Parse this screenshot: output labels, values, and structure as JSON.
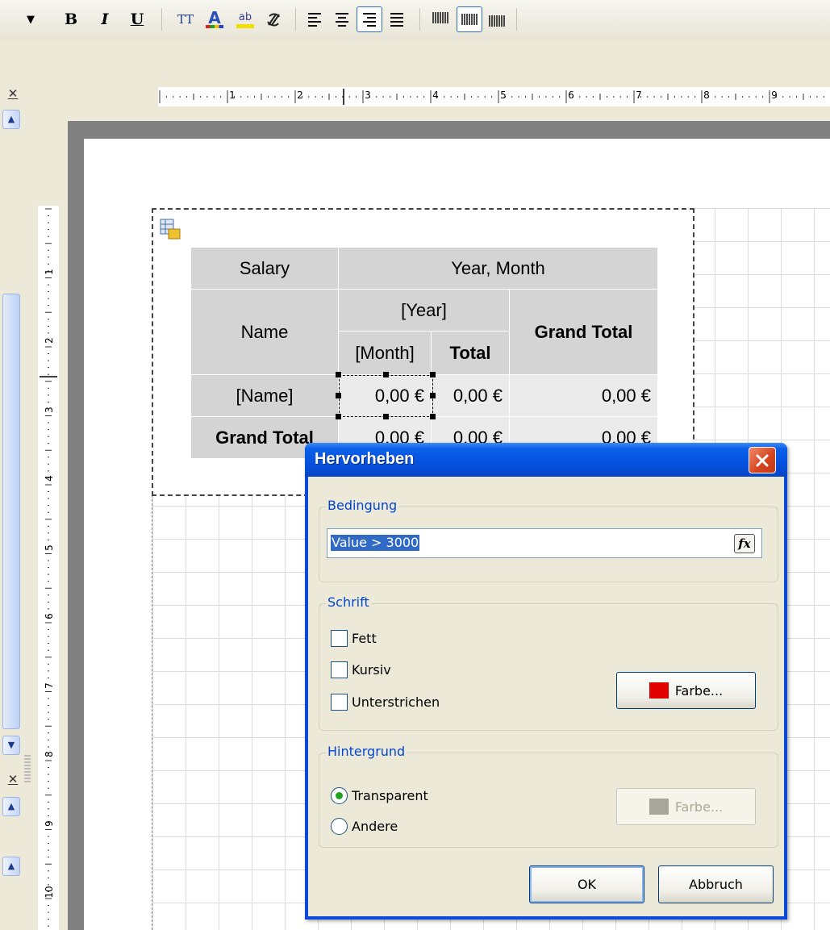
{
  "toolbar": {
    "bold_glyph": "B",
    "italic_glyph": "I",
    "underline_glyph": "U",
    "font_size_glyph": "TT",
    "font_color_glyph": "A",
    "highlight_glyph": "ab"
  },
  "rulers": {
    "horizontal_numbers": [
      "1",
      "2",
      "3",
      "4",
      "5",
      "6",
      "7",
      "8",
      "9"
    ],
    "vertical_numbers": [
      "1",
      "2",
      "3",
      "4",
      "5",
      "6",
      "7",
      "8",
      "9",
      "10"
    ]
  },
  "crosstab": {
    "salary": "Salary",
    "year_month": "Year, Month",
    "name": "Name",
    "year": "[Year]",
    "grand_total_header": "Grand Total",
    "month": "[Month]",
    "total": "Total",
    "name_field": "[Name]",
    "cell_value": "0,00 €",
    "total_value": "0,00 €",
    "grand_total_value": "0,00 €",
    "grand_total_row": "Grand Total",
    "row2_cell": "0,00 €",
    "row2_total": "0,00 €",
    "row2_grand": "0,00 €"
  },
  "dialog": {
    "title": "Hervorheben",
    "condition_group": "Bedingung",
    "condition_value": "Value > 3000",
    "fx_label": "fx",
    "font_group": "Schrift",
    "bold_label": "Fett",
    "italic_label": "Kursiv",
    "underline_label": "Unterstrichen",
    "font_color_button": "Farbe...",
    "font_color": "#e00000",
    "background_group": "Hintergrund",
    "transparent_label": "Transparent",
    "other_label": "Andere",
    "background_color_button": "Farbe...",
    "background_color": "#a8a59a",
    "ok_button": "OK",
    "cancel_button": "Abbruch",
    "checkboxes": {
      "bold": false,
      "italic": false,
      "underline": false
    },
    "selected_background": "Transparent"
  }
}
